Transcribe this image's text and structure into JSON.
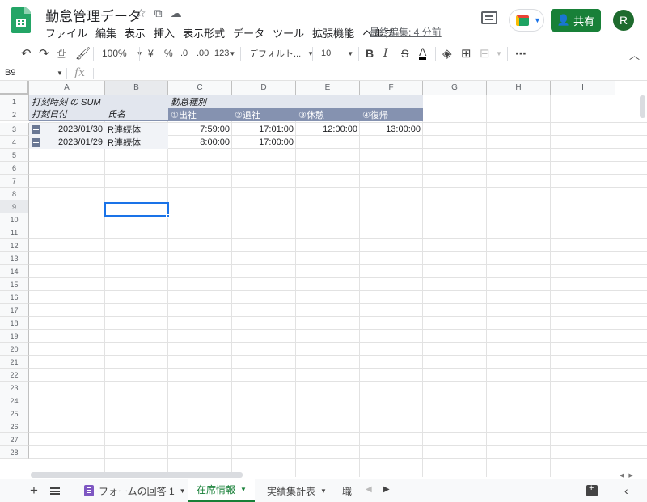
{
  "header": {
    "doc_title": "勤怠管理データ",
    "menu": [
      "ファイル",
      "編集",
      "表示",
      "挿入",
      "表示形式",
      "データ",
      "ツール",
      "拡張機能",
      "ヘルプ"
    ],
    "last_edit": "最終編集: 4 分前",
    "share_label": "共有",
    "avatar_initial": "R"
  },
  "toolbar": {
    "zoom": "100%",
    "currency": "¥",
    "percent": "%",
    "dec_decrease": ".0",
    "dec_increase": ".00",
    "more_formats": "123",
    "font": "デフォルト...",
    "font_size": "10",
    "bold": "B",
    "italic": "I",
    "strike": "S",
    "text_color": "A"
  },
  "formula_bar": {
    "cell_ref": "B9",
    "fx": "fx",
    "content": ""
  },
  "grid": {
    "columns": [
      "A",
      "B",
      "C",
      "D",
      "E",
      "F",
      "G",
      "H",
      "I"
    ],
    "rows": [
      "1",
      "2",
      "3",
      "4",
      "5",
      "6",
      "7",
      "8",
      "9",
      "10",
      "11",
      "12",
      "13",
      "14",
      "15",
      "16",
      "17",
      "18",
      "19",
      "20",
      "21",
      "22",
      "23",
      "24",
      "25",
      "26",
      "27",
      "28"
    ],
    "selected_column": "B",
    "selected_row": "9",
    "pivot": {
      "value_header": "打刻時刻 の SUM",
      "column_field": "勤怠種別",
      "row_field_date": "打刻日付",
      "row_field_name": "氏名",
      "col_values": [
        "①出社",
        "②退社",
        "③休憩",
        "④復帰"
      ],
      "rows": [
        {
          "date": "2023/01/30",
          "name": "R連続体",
          "values": [
            "7:59:00",
            "17:01:00",
            "12:00:00",
            "13:00:00"
          ]
        },
        {
          "date": "2023/01/29",
          "name": "R連続体",
          "values": [
            "8:00:00",
            "17:00:00",
            "",
            ""
          ]
        }
      ]
    }
  },
  "sheets": {
    "tabs": [
      {
        "label": "フォームの回答 1",
        "active": false
      },
      {
        "label": "在席情報",
        "active": true
      },
      {
        "label": "実績集計表",
        "active": false
      },
      {
        "label": "職",
        "active": false
      }
    ]
  },
  "colors": {
    "brand_green": "#188038",
    "pivot_header": "#8592b0",
    "pivot_light": "#e2e6ee",
    "selection": "#1a73e8"
  }
}
